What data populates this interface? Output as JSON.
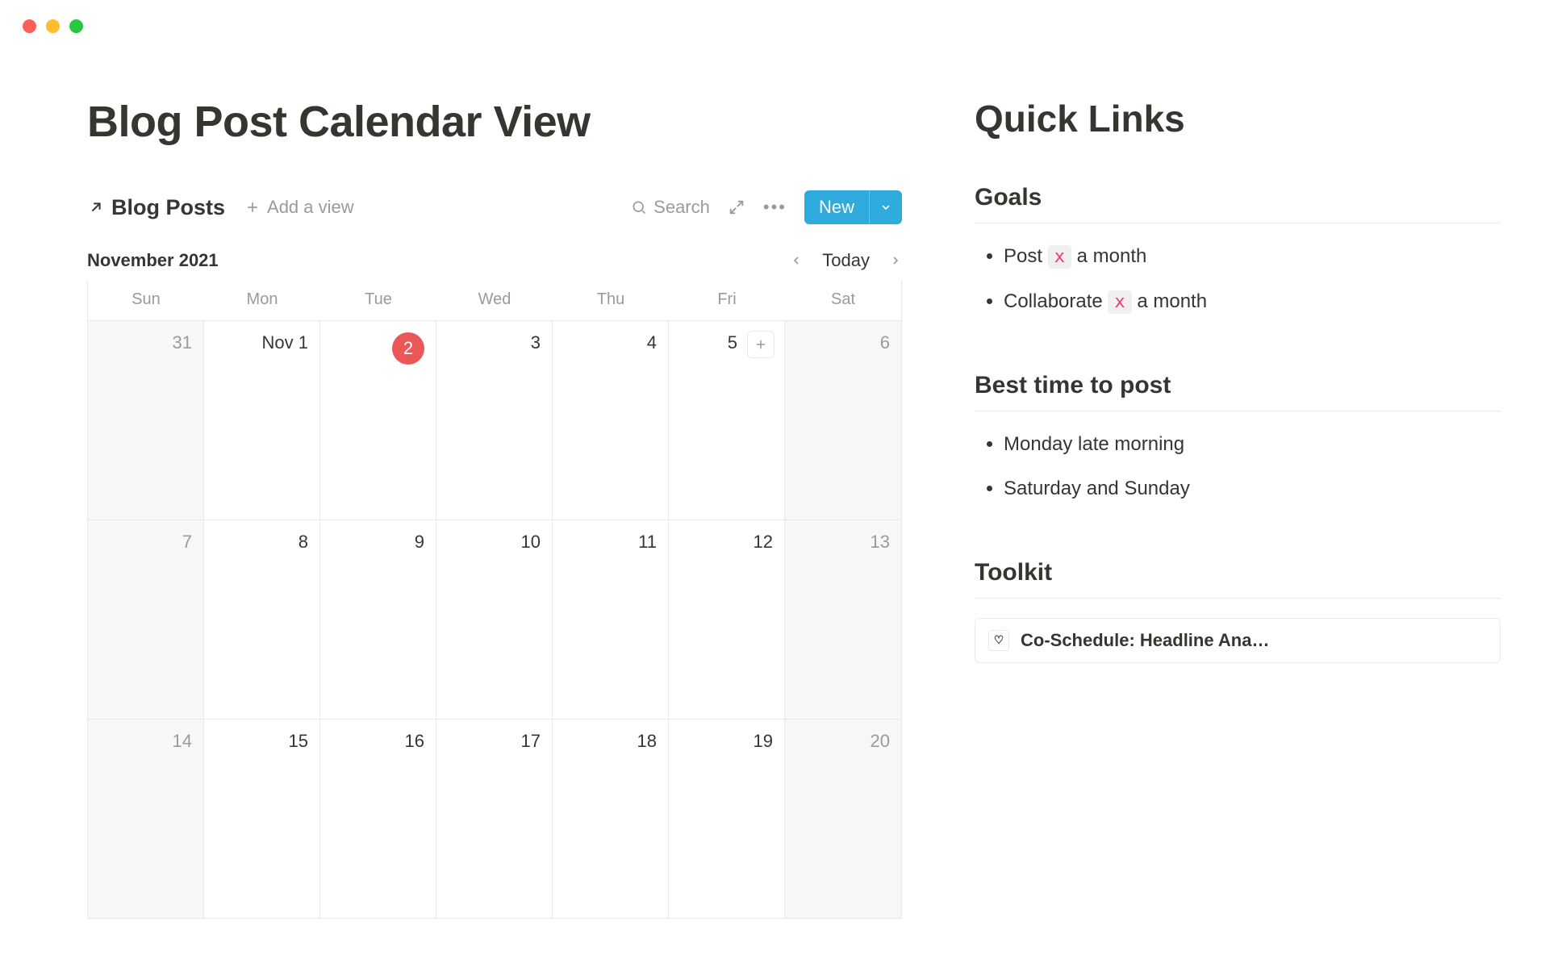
{
  "page": {
    "title": "Blog Post Calendar View"
  },
  "database": {
    "link_label": "Blog Posts",
    "add_view_label": "Add a view",
    "search_label": "Search",
    "new_button": "New"
  },
  "calendar": {
    "month_label": "November 2021",
    "today_label": "Today",
    "weekdays": [
      "Sun",
      "Mon",
      "Tue",
      "Wed",
      "Thu",
      "Fri",
      "Sat"
    ],
    "weeks": [
      [
        {
          "label": "31",
          "outside": true
        },
        {
          "label": "Nov 1"
        },
        {
          "label": "2",
          "today": true
        },
        {
          "label": "3"
        },
        {
          "label": "4"
        },
        {
          "label": "5",
          "show_add": true
        },
        {
          "label": "6",
          "outside": true
        }
      ],
      [
        {
          "label": "7",
          "outside": true
        },
        {
          "label": "8"
        },
        {
          "label": "9"
        },
        {
          "label": "10"
        },
        {
          "label": "11"
        },
        {
          "label": "12"
        },
        {
          "label": "13",
          "outside": true
        }
      ],
      [
        {
          "label": "14",
          "outside": true
        },
        {
          "label": "15"
        },
        {
          "label": "16"
        },
        {
          "label": "17"
        },
        {
          "label": "18"
        },
        {
          "label": "19"
        },
        {
          "label": "20",
          "outside": true
        }
      ]
    ]
  },
  "quick_links": {
    "title": "Quick Links",
    "goals": {
      "title": "Goals",
      "items": [
        {
          "pre": "Post ",
          "code": "x",
          "post": " a month"
        },
        {
          "pre": "Collaborate ",
          "code": "x",
          "post": " a month"
        }
      ]
    },
    "best_time": {
      "title": "Best time to post",
      "items": [
        "Monday late morning",
        "Saturday and Sunday"
      ]
    },
    "toolkit": {
      "title": "Toolkit",
      "items": [
        {
          "icon": "♡",
          "label": "Co-Schedule: Headline Ana…"
        }
      ]
    }
  }
}
